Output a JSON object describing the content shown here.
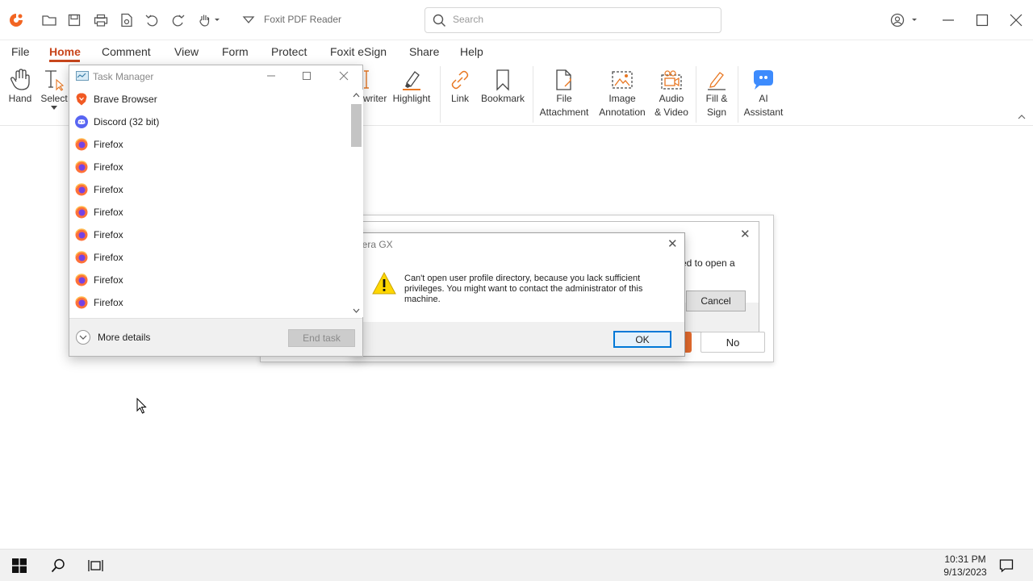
{
  "app": {
    "title": "Foxit PDF Reader",
    "search_placeholder": "Search"
  },
  "menu": [
    "File",
    "Home",
    "Comment",
    "View",
    "Form",
    "Protect",
    "Foxit eSign",
    "Share",
    "Help"
  ],
  "ribbon": {
    "hand": "Hand",
    "select": "Select",
    "typewriter": "writer",
    "highlight": "Highlight",
    "link": "Link",
    "bookmark": "Bookmark",
    "file_attachment": [
      "File",
      "Attachment"
    ],
    "image_annotation": [
      "Image",
      "Annotation"
    ],
    "audio_video": [
      "Audio",
      "& Video"
    ],
    "fill_sign": [
      "Fill &",
      "Sign"
    ],
    "ai_assistant": [
      "AI",
      "Assistant"
    ]
  },
  "task_manager": {
    "title": "Task Manager",
    "processes": [
      "Brave Browser",
      "Discord (32 bit)",
      "Firefox",
      "Firefox",
      "Firefox",
      "Firefox",
      "Firefox",
      "Firefox",
      "Firefox",
      "Firefox"
    ],
    "more_details": "More details",
    "end_task": "End task"
  },
  "bg_dialog": {
    "text": "ed to open a",
    "cancel": "Cancel",
    "no": "No"
  },
  "error_dialog": {
    "title": "pera GX",
    "message": "Can't open user profile directory, because you lack sufficient privileges. You might want to contact the administrator of this machine.",
    "ok": "OK"
  },
  "taskbar": {
    "time": "10:31 PM",
    "date": "9/13/2023"
  },
  "colors": {
    "accent": "#c8461c",
    "brave": "#f15a24",
    "discord": "#5865f2",
    "firefox": "#ff7139",
    "ai": "#3d8bfd",
    "warning": "#ffd700"
  }
}
